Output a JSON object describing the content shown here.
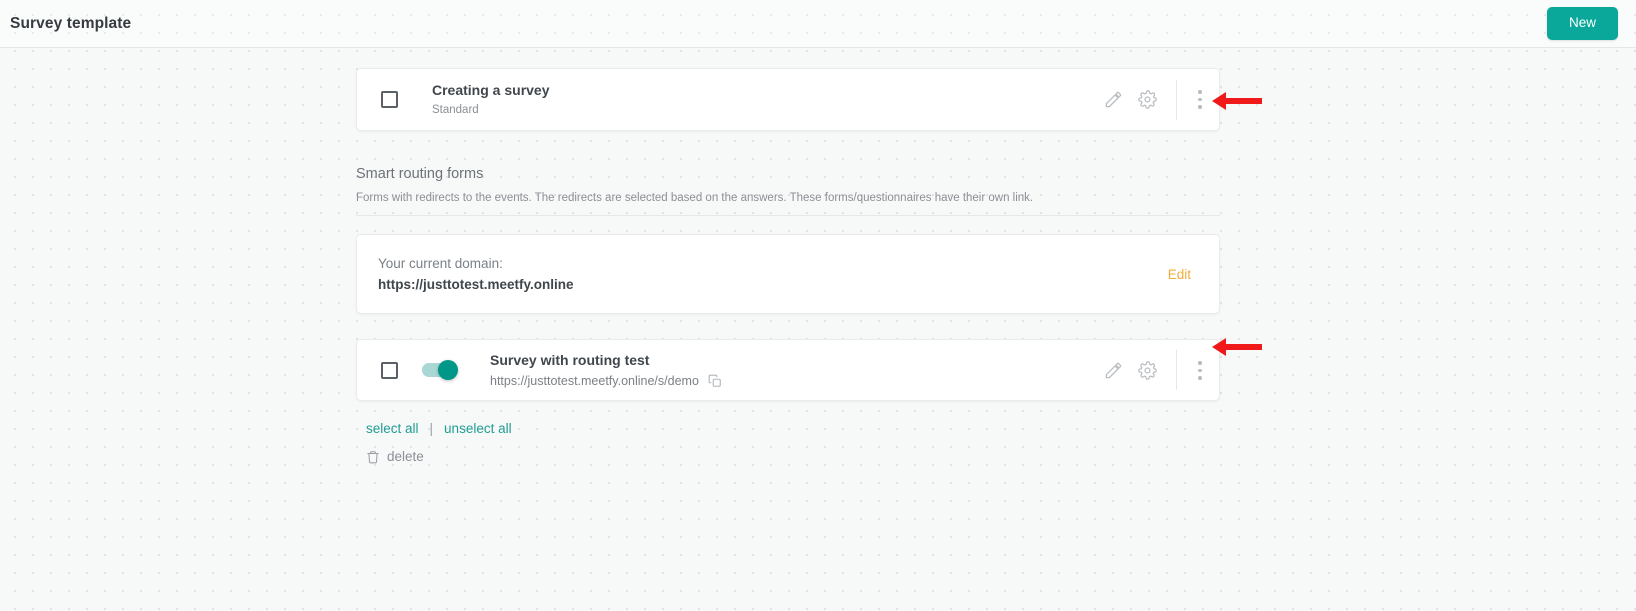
{
  "header": {
    "title": "Survey template",
    "new_button": "New",
    "accent_color": "#0aa89a"
  },
  "surveys": [
    {
      "title": "Creating a survey",
      "subtitle": "Standard",
      "has_toggle": false,
      "checked": false
    },
    {
      "title": "Survey with routing test",
      "subtitle": "https://justtotest.meetfy.online/s/demo",
      "has_toggle": true,
      "toggle_on": true,
      "checked": false
    }
  ],
  "section": {
    "title": "Smart routing forms",
    "description": "Forms with redirects to the events. The redirects are selected based on the answers. These forms/questionnaires have their own link."
  },
  "domain": {
    "label": "Your current domain:",
    "url": "https://justtotest.meetfy.online",
    "edit_label": "Edit",
    "edit_color": "#f0ad3e"
  },
  "bulk_actions": {
    "select_all": "select all",
    "separator": "|",
    "unselect_all": "unselect all",
    "delete": "delete",
    "link_color": "#1f9e94"
  },
  "annotations": {
    "arrow_color": "#f01a1a",
    "count": 2
  }
}
